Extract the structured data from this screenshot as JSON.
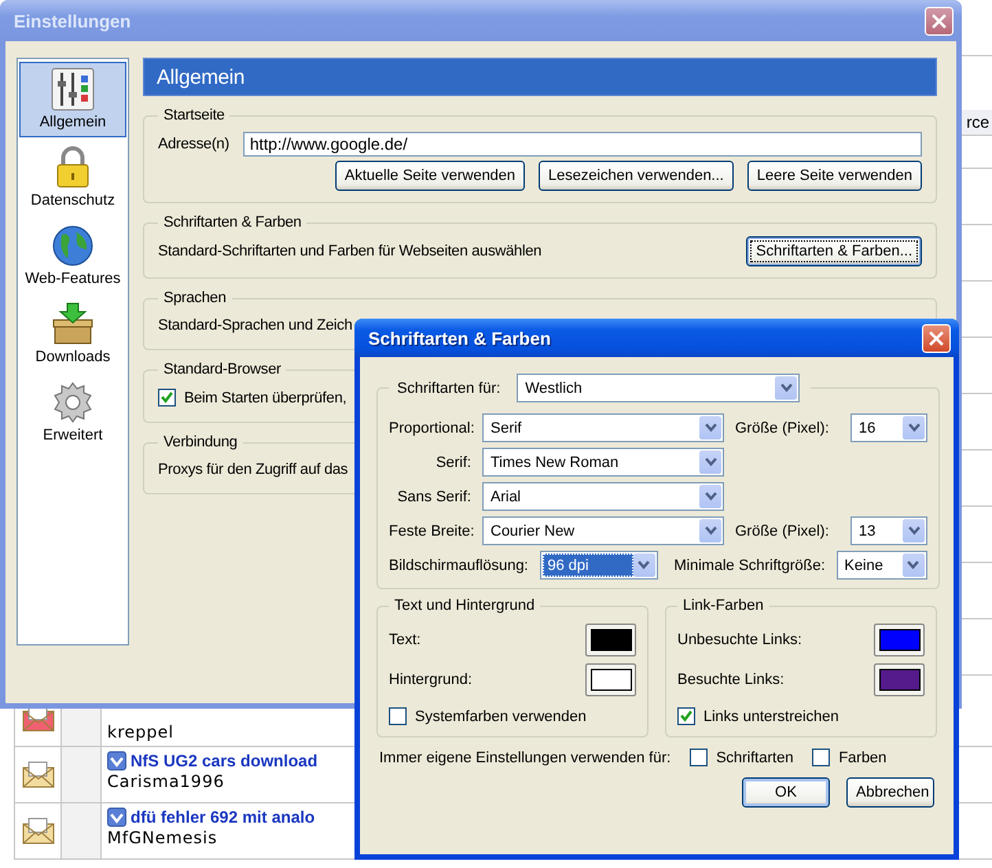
{
  "background_page": {
    "column_fragment": "rce",
    "topics": [
      {
        "author": "kreppel",
        "hot": true
      },
      {
        "title": "NfS UG2 cars download",
        "author": "Carisma1996",
        "hot": false
      },
      {
        "title": "dfü fehler 692 mit analo",
        "author": "MfGNemesis",
        "hot": false
      }
    ]
  },
  "settings_window": {
    "title": "Einstellungen",
    "sidebar": {
      "items": [
        {
          "label": "Allgemein",
          "selected": true
        },
        {
          "label": "Datenschutz",
          "selected": false
        },
        {
          "label": "Web-Features",
          "selected": false
        },
        {
          "label": "Downloads",
          "selected": false
        },
        {
          "label": "Erweitert",
          "selected": false
        }
      ]
    },
    "panel_title": "Allgemein",
    "groups": [
      {
        "kind": "address",
        "legend": "Startseite",
        "label": "Adresse(n)",
        "value": "http://www.google.de/",
        "buttons": [
          "Aktuelle Seite verwenden",
          "Lesezeichen verwenden...",
          "Leere Seite verwenden"
        ]
      },
      {
        "kind": "text_button",
        "legend": "Schriftarten & Farben",
        "text": "Standard-Schriftarten und Farben für Webseiten auswählen",
        "button": "Schriftarten & Farben..."
      },
      {
        "kind": "text",
        "legend": "Sprachen",
        "text": "Standard-Sprachen und Zeich"
      },
      {
        "kind": "checkbox",
        "legend": "Standard-Browser",
        "text": "Beim Starten überprüfen,",
        "checked": true
      },
      {
        "kind": "text",
        "legend": "Verbindung",
        "text": "Proxys für den Zugriff auf das"
      }
    ]
  },
  "fonts_dialog": {
    "title": "Schriftarten & Farben",
    "fonts": {
      "for_label": "Schriftarten für:",
      "for_value": "Westlich",
      "rows": [
        {
          "label": "Proportional:",
          "value": "Serif",
          "size_label": "Größe (Pixel):",
          "size_value": "16"
        },
        {
          "label": "Serif:",
          "value": "Times New Roman"
        },
        {
          "label": "Sans Serif:",
          "value": "Arial"
        },
        {
          "label": "Feste Breite:",
          "value": "Courier New",
          "size_label": "Größe (Pixel):",
          "size_value": "13"
        }
      ],
      "resolution": {
        "label": "Bildschirmauflösung:",
        "value": "96 dpi",
        "focused": true
      },
      "minimum": {
        "label": "Minimale Schriftgröße:",
        "value": "Keine",
        "focused": false
      }
    },
    "color_groups": [
      {
        "legend": "Text und Hintergrund",
        "colors": [
          {
            "label": "Text:",
            "color": "#000000"
          },
          {
            "label": "Hintergrund:",
            "color": "#ffffff"
          }
        ],
        "checkbox": {
          "label": "Systemfarben verwenden",
          "checked": false
        }
      },
      {
        "legend": "Link-Farben",
        "colors": [
          {
            "label": "Unbesuchte Links:",
            "color": "#0000ff"
          },
          {
            "label": "Besuchte Links:",
            "color": "#551a8b"
          }
        ],
        "checkbox": {
          "label": "Links unterstreichen",
          "checked": true
        }
      }
    ],
    "override": {
      "label": "Immer eigene Einstellungen verwenden für:",
      "options": [
        {
          "label": "Schriftarten",
          "checked": false
        },
        {
          "label": "Farben",
          "checked": false
        }
      ]
    },
    "buttons": [
      {
        "label": "OK",
        "default": true
      },
      {
        "label": "Abbrechen",
        "default": false
      }
    ]
  }
}
